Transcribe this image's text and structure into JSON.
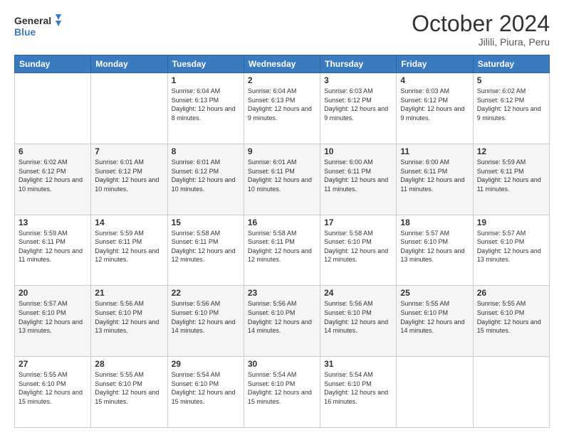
{
  "header": {
    "logo": {
      "line1": "General",
      "line2": "Blue"
    },
    "title": "October 2024",
    "subtitle": "Jilili, Piura, Peru"
  },
  "days_of_week": [
    "Sunday",
    "Monday",
    "Tuesday",
    "Wednesday",
    "Thursday",
    "Friday",
    "Saturday"
  ],
  "weeks": [
    [
      {
        "day": "",
        "info": ""
      },
      {
        "day": "",
        "info": ""
      },
      {
        "day": "1",
        "info": "Sunrise: 6:04 AM\nSunset: 6:13 PM\nDaylight: 12 hours and 8 minutes."
      },
      {
        "day": "2",
        "info": "Sunrise: 6:04 AM\nSunset: 6:13 PM\nDaylight: 12 hours and 9 minutes."
      },
      {
        "day": "3",
        "info": "Sunrise: 6:03 AM\nSunset: 6:12 PM\nDaylight: 12 hours and 9 minutes."
      },
      {
        "day": "4",
        "info": "Sunrise: 6:03 AM\nSunset: 6:12 PM\nDaylight: 12 hours and 9 minutes."
      },
      {
        "day": "5",
        "info": "Sunrise: 6:02 AM\nSunset: 6:12 PM\nDaylight: 12 hours and 9 minutes."
      }
    ],
    [
      {
        "day": "6",
        "info": "Sunrise: 6:02 AM\nSunset: 6:12 PM\nDaylight: 12 hours and 10 minutes."
      },
      {
        "day": "7",
        "info": "Sunrise: 6:01 AM\nSunset: 6:12 PM\nDaylight: 12 hours and 10 minutes."
      },
      {
        "day": "8",
        "info": "Sunrise: 6:01 AM\nSunset: 6:12 PM\nDaylight: 12 hours and 10 minutes."
      },
      {
        "day": "9",
        "info": "Sunrise: 6:01 AM\nSunset: 6:11 PM\nDaylight: 12 hours and 10 minutes."
      },
      {
        "day": "10",
        "info": "Sunrise: 6:00 AM\nSunset: 6:11 PM\nDaylight: 12 hours and 11 minutes."
      },
      {
        "day": "11",
        "info": "Sunrise: 6:00 AM\nSunset: 6:11 PM\nDaylight: 12 hours and 11 minutes."
      },
      {
        "day": "12",
        "info": "Sunrise: 5:59 AM\nSunset: 6:11 PM\nDaylight: 12 hours and 11 minutes."
      }
    ],
    [
      {
        "day": "13",
        "info": "Sunrise: 5:59 AM\nSunset: 6:11 PM\nDaylight: 12 hours and 11 minutes."
      },
      {
        "day": "14",
        "info": "Sunrise: 5:59 AM\nSunset: 6:11 PM\nDaylight: 12 hours and 12 minutes."
      },
      {
        "day": "15",
        "info": "Sunrise: 5:58 AM\nSunset: 6:11 PM\nDaylight: 12 hours and 12 minutes."
      },
      {
        "day": "16",
        "info": "Sunrise: 5:58 AM\nSunset: 6:11 PM\nDaylight: 12 hours and 12 minutes."
      },
      {
        "day": "17",
        "info": "Sunrise: 5:58 AM\nSunset: 6:10 PM\nDaylight: 12 hours and 12 minutes."
      },
      {
        "day": "18",
        "info": "Sunrise: 5:57 AM\nSunset: 6:10 PM\nDaylight: 12 hours and 13 minutes."
      },
      {
        "day": "19",
        "info": "Sunrise: 5:57 AM\nSunset: 6:10 PM\nDaylight: 12 hours and 13 minutes."
      }
    ],
    [
      {
        "day": "20",
        "info": "Sunrise: 5:57 AM\nSunset: 6:10 PM\nDaylight: 12 hours and 13 minutes."
      },
      {
        "day": "21",
        "info": "Sunrise: 5:56 AM\nSunset: 6:10 PM\nDaylight: 12 hours and 13 minutes."
      },
      {
        "day": "22",
        "info": "Sunrise: 5:56 AM\nSunset: 6:10 PM\nDaylight: 12 hours and 14 minutes."
      },
      {
        "day": "23",
        "info": "Sunrise: 5:56 AM\nSunset: 6:10 PM\nDaylight: 12 hours and 14 minutes."
      },
      {
        "day": "24",
        "info": "Sunrise: 5:56 AM\nSunset: 6:10 PM\nDaylight: 12 hours and 14 minutes."
      },
      {
        "day": "25",
        "info": "Sunrise: 5:55 AM\nSunset: 6:10 PM\nDaylight: 12 hours and 14 minutes."
      },
      {
        "day": "26",
        "info": "Sunrise: 5:55 AM\nSunset: 6:10 PM\nDaylight: 12 hours and 15 minutes."
      }
    ],
    [
      {
        "day": "27",
        "info": "Sunrise: 5:55 AM\nSunset: 6:10 PM\nDaylight: 12 hours and 15 minutes."
      },
      {
        "day": "28",
        "info": "Sunrise: 5:55 AM\nSunset: 6:10 PM\nDaylight: 12 hours and 15 minutes."
      },
      {
        "day": "29",
        "info": "Sunrise: 5:54 AM\nSunset: 6:10 PM\nDaylight: 12 hours and 15 minutes."
      },
      {
        "day": "30",
        "info": "Sunrise: 5:54 AM\nSunset: 6:10 PM\nDaylight: 12 hours and 15 minutes."
      },
      {
        "day": "31",
        "info": "Sunrise: 5:54 AM\nSunset: 6:10 PM\nDaylight: 12 hours and 16 minutes."
      },
      {
        "day": "",
        "info": ""
      },
      {
        "day": "",
        "info": ""
      }
    ]
  ]
}
